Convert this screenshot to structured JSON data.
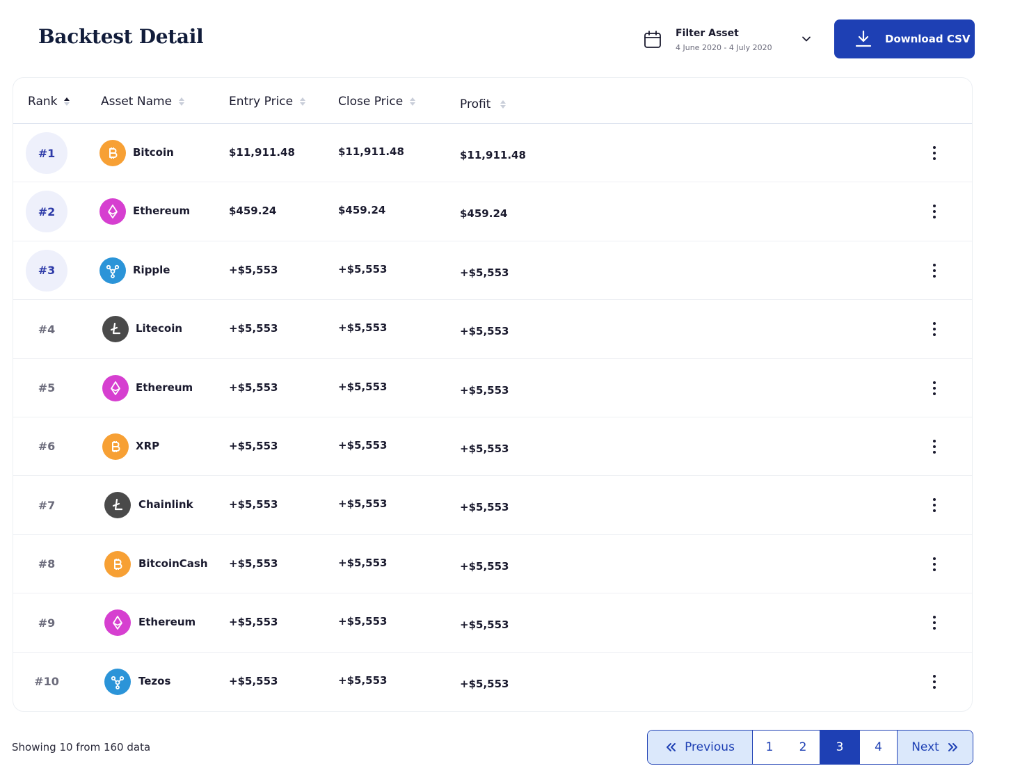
{
  "header": {
    "title": "Backtest Detail",
    "filter_title": "Filter Asset",
    "filter_range": "4 June 2020 - 4 July 2020",
    "download_label": "Download CSV"
  },
  "table": {
    "columns": [
      "Rank",
      "Asset Name",
      "Entry Price",
      "Close Price",
      "Profit"
    ],
    "rows": [
      {
        "rank": "#1",
        "asset": "Bitcoin",
        "icon": "bitcoin-icon",
        "entry": "$11,911.48",
        "close": "$11,911.48",
        "profit": "$11,911.48"
      },
      {
        "rank": "#2",
        "asset": "Ethereum",
        "icon": "ethereum-icon",
        "entry": "$459.24",
        "close": "$459.24",
        "profit": "$459.24"
      },
      {
        "rank": "#3",
        "asset": "Ripple",
        "icon": "ripple-icon",
        "entry": "+$5,553",
        "close": "+$5,553",
        "profit": "+$5,553"
      },
      {
        "rank": "#4",
        "asset": "Litecoin",
        "icon": "litecoin-icon",
        "entry": "+$5,553",
        "close": "+$5,553",
        "profit": "+$5,553"
      },
      {
        "rank": "#5",
        "asset": "Ethereum",
        "icon": "ethereum-icon",
        "entry": "+$5,553",
        "close": "+$5,553",
        "profit": "+$5,553"
      },
      {
        "rank": "#6",
        "asset": "XRP",
        "icon": "bitcoin-icon",
        "entry": "+$5,553",
        "close": "+$5,553",
        "profit": "+$5,553"
      },
      {
        "rank": "#7",
        "asset": "Chainlink",
        "icon": "litecoin-icon",
        "entry": "+$5,553",
        "close": "+$5,553",
        "profit": "+$5,553"
      },
      {
        "rank": "#8",
        "asset": "BitcoinCash",
        "icon": "bitcoin-icon",
        "entry": "+$5,553",
        "close": "+$5,553",
        "profit": "+$5,553"
      },
      {
        "rank": "#9",
        "asset": "Ethereum",
        "icon": "ethereum-icon",
        "entry": "+$5,553",
        "close": "+$5,553",
        "profit": "+$5,553"
      },
      {
        "rank": "#10",
        "asset": "Tezos",
        "icon": "ripple-icon",
        "entry": "+$5,553",
        "close": "+$5,553",
        "profit": "+$5,553"
      }
    ]
  },
  "footer": {
    "showing": "Showing 10 from 160 data",
    "prev_label": "Previous",
    "next_label": "Next",
    "pages": [
      "1",
      "2",
      "3",
      "4"
    ],
    "current_page": "3"
  },
  "colors": {
    "accent": "#1e40b4",
    "accent_light": "#dbe8fb",
    "bitcoin": "#f7a034",
    "ethereum": "#d63fd0",
    "ripple": "#2b94d8",
    "litecoin": "#4a4a4a",
    "rank_highlight": "#eef0fb"
  }
}
